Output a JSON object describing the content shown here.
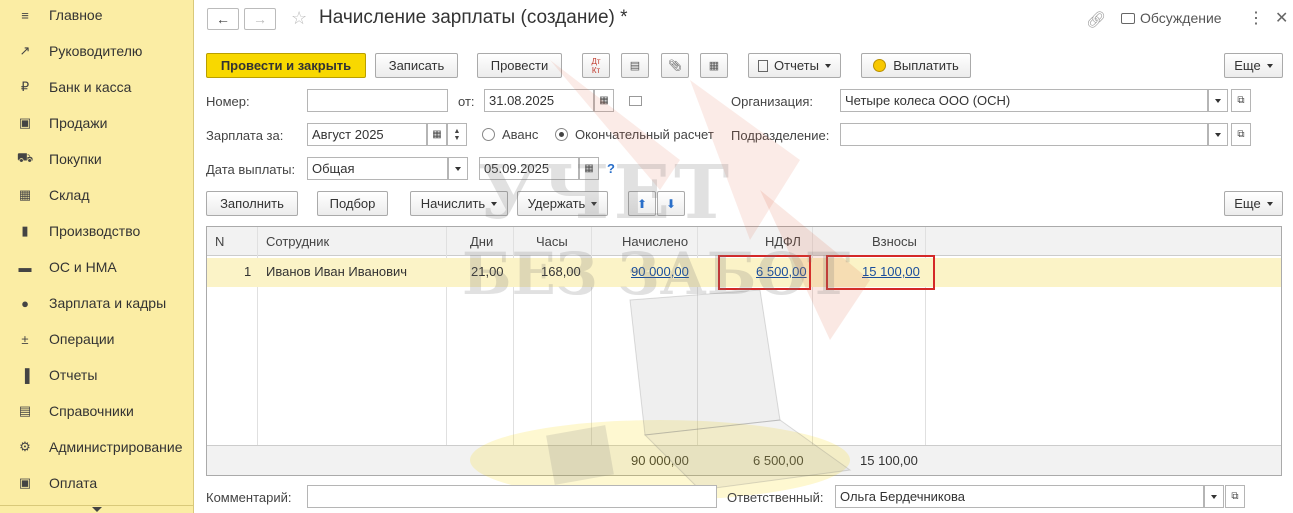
{
  "sidebar": {
    "items": [
      {
        "label": "Главное",
        "icon": "menu-icon"
      },
      {
        "label": "Руководителю",
        "icon": "trend-icon"
      },
      {
        "label": "Банк и касса",
        "icon": "coin-icon"
      },
      {
        "label": "Продажи",
        "icon": "bag-icon"
      },
      {
        "label": "Покупки",
        "icon": "cart-icon"
      },
      {
        "label": "Склад",
        "icon": "warehouse-icon"
      },
      {
        "label": "Производство",
        "icon": "factory-icon"
      },
      {
        "label": "ОС и НМА",
        "icon": "truck-icon"
      },
      {
        "label": "Зарплата и кадры",
        "icon": "person-icon"
      },
      {
        "label": "Операции",
        "icon": "dt-kt-icon"
      },
      {
        "label": "Отчеты",
        "icon": "bar-chart-icon"
      },
      {
        "label": "Справочники",
        "icon": "books-icon"
      },
      {
        "label": "Администрирование",
        "icon": "gear-icon"
      },
      {
        "label": "Оплата",
        "icon": "payment-icon"
      }
    ]
  },
  "header": {
    "title": "Начисление зарплаты (создание) *",
    "discuss": "Обсуждение"
  },
  "toolbar": {
    "post_close": "Провести и закрыть",
    "save": "Записать",
    "post": "Провести",
    "dtkt_top": "Дт",
    "dtkt_bottom": "Кт",
    "reports": "Отчеты",
    "pay": "Выплатить",
    "more": "Еще"
  },
  "form": {
    "number_label": "Номер:",
    "number_value": "",
    "date_label": "от:",
    "date_value": "31.08.2025",
    "org_label": "Организация:",
    "org_value": "Четыре колеса ООО (ОСН)",
    "salary_for_label": "Зарплата за:",
    "salary_for_value": "Август 2025",
    "advance_label": "Аванс",
    "final_label": "Окончательный расчет",
    "dept_label": "Подразделение:",
    "dept_value": "",
    "pay_date_label": "Дата выплаты:",
    "pay_date_type": "Общая",
    "pay_date_value": "05.09.2025",
    "help": "?"
  },
  "table_toolbar": {
    "fill": "Заполнить",
    "select": "Подбор",
    "accrue": "Начислить",
    "withhold": "Удержать",
    "more": "Еще"
  },
  "table": {
    "headers": {
      "n": "N",
      "employee": "Сотрудник",
      "days": "Дни",
      "hours": "Часы",
      "accrued": "Начислено",
      "ndfl": "НДФЛ",
      "contrib": "Взносы"
    },
    "rows": [
      {
        "n": "1",
        "employee": "Иванов Иван Иванович",
        "days": "21,00",
        "hours": "168,00",
        "accrued": "90 000,00",
        "ndfl": "6 500,00",
        "contrib": "15 100,00"
      }
    ],
    "totals": {
      "accrued": "90 000,00",
      "ndfl": "6 500,00",
      "contrib": "15 100,00"
    }
  },
  "footer": {
    "comment_label": "Комментарий:",
    "comment_value": "",
    "responsible_label": "Ответственный:",
    "responsible_value": "Ольга Бердечникова"
  },
  "watermark": {
    "line1": "УЧЕТ",
    "line2": "БЕЗ ЗАБОТ"
  }
}
